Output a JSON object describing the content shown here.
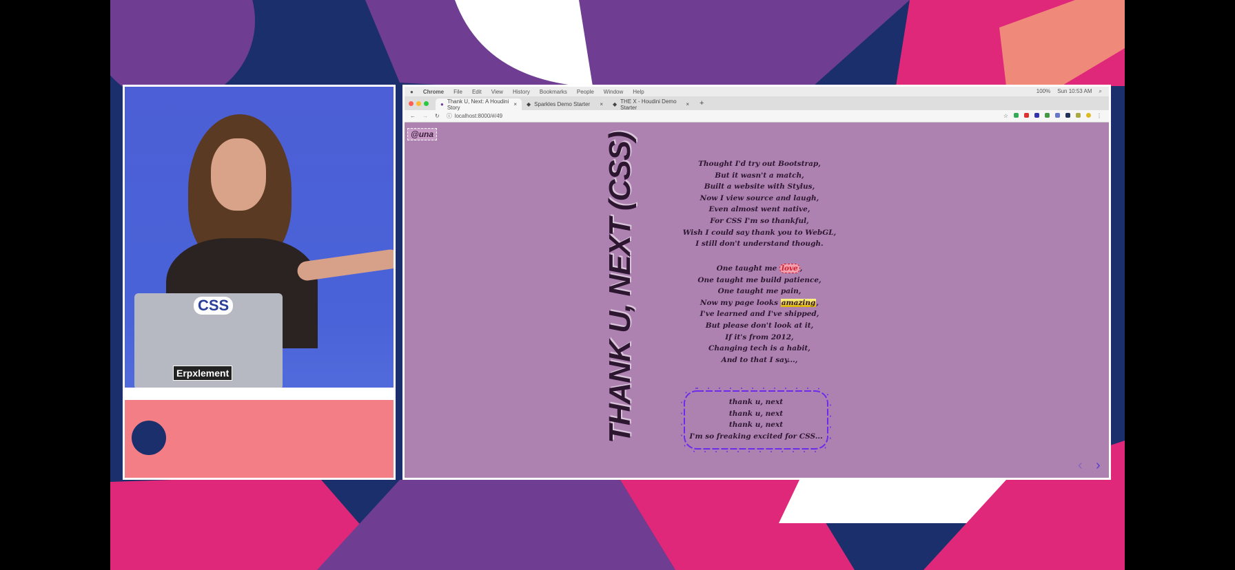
{
  "browser": {
    "menu": [
      "Chrome",
      "File",
      "Edit",
      "View",
      "History",
      "Bookmarks",
      "People",
      "Window",
      "Help"
    ],
    "status": [
      "100%",
      "Sun 10:53 AM"
    ],
    "tabs": [
      {
        "label": "Thank U, Next: A Houdini Story"
      },
      {
        "label": "Sparkles Demo Starter"
      },
      {
        "label": "THE X - Houdini Demo Starter"
      }
    ],
    "new_tab": "+",
    "close": "×",
    "url": "localhost:8000/#/49"
  },
  "slide": {
    "handle": "@una",
    "title": "THANK U, NEXT (CSS)",
    "stanza1": [
      "Thought I'd try out Bootstrap,",
      "But it wasn't a match,",
      "Built a website with Stylus,",
      "Now I view source and laugh,",
      "Even almost went native,",
      "For CSS I'm so thankful,",
      "Wish I could say thank you to WebGL,",
      "I still don't understand though."
    ],
    "stanza2": {
      "l1_pre": "One taught me ",
      "l1_word": "love",
      "l1_post": ",",
      "l2": "One taught me build patience,",
      "l3": "One taught me pain,",
      "l4_pre": "Now my page looks ",
      "l4_word": "amazing",
      "l4_post": ",",
      "rest": [
        "I've learned and I've shipped,",
        "But please don't look at it,",
        "If it's from 2012,",
        "Changing tech is a habit,",
        "And to that I say...,"
      ]
    },
    "chorus": [
      "thank u, next",
      "thank u, next",
      "thank u, next",
      "I'm so freaking excited for CSS..."
    ],
    "prev": "‹",
    "next": "›"
  },
  "speaker": {
    "laptop_stickers": [
      "CSS",
      "Erpxlement"
    ]
  },
  "colors": {
    "navy": "#1a2f6b",
    "purple": "#6f3d92",
    "pink": "#e0287a",
    "salmon": "#ef8a7a",
    "slide_bg": "#ad82b1"
  }
}
